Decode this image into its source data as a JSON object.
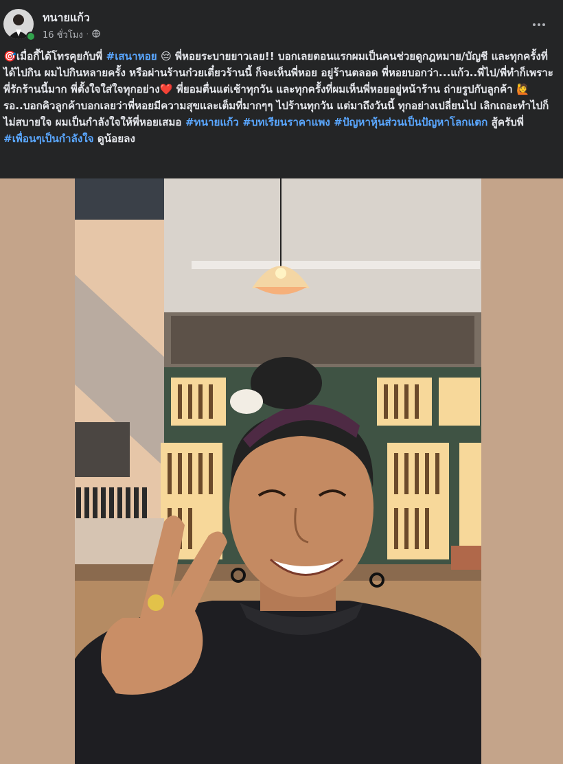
{
  "post": {
    "author": "ทนายแก้ว",
    "time": "16 ชั่วโมง",
    "privacy_icon": "globe-icon",
    "more_icon": "more-horizontal-icon",
    "caption_segments": [
      {
        "type": "emoji",
        "text": "🎯"
      },
      {
        "type": "text",
        "text": "เมื่อกี้ได้โทรคุยกับพี่ "
      },
      {
        "type": "tag",
        "text": "#เสนาหอย"
      },
      {
        "type": "text",
        "text": " 😔 พี่หอยระบายยาวเลย!! บอกเลยตอนแรกผมเป็นคนช่วยดูกฎหมาย/บัญชี และทุกครั้งที่ได้ไปกิน ผมไปกินหลายครั้ง หรือผ่านร้านก๋วยเตี๋ยวร้านนี้ ก็จะเห็นพี่หอย อยู่ร้านตลอด พี่หอยบอกว่า...แก้ว..พี่ไป/พี่ทำก็เพราะพี่รักร้านนี้มาก พี่ตั้งใจใส่ใจทุกอย่าง"
      },
      {
        "type": "heart",
        "text": "❤️"
      },
      {
        "type": "text",
        "text": " พี่ยอมตื่นแต่เช้าทุกวัน และทุกครั้งที่ผมเห็นพี่หอยอยู่หน้าร้าน ถ่ายรูปกับลูกค้า 🙋รอ..บอกคิวลูกค้าบอกเลยว่าพี่หอยมีความสุขและเต็มที่มากๆๆ ไปร้านทุกวัน แต่มาถึงวันนี้ ทุกอย่างเปลี่ยนไป เลิกเถอะทำไปก็ไม่สบายใจ ผมเป็นกำลังใจให้พี่หอยเสมอ "
      },
      {
        "type": "tag",
        "text": "#ทนายแก้ว"
      },
      {
        "type": "text",
        "text": " "
      },
      {
        "type": "tag",
        "text": "#บทเรียนราคาแพง"
      },
      {
        "type": "text",
        "text": " "
      },
      {
        "type": "tag",
        "text": "#ปัญหาหุ้นส่วนเป็นปัญหาโลกแตก"
      },
      {
        "type": "text",
        "text": " สู้ครับพี่ "
      },
      {
        "type": "tag",
        "text": "#เพื่อนๆเป็นกำลังใจ"
      },
      {
        "type": "text",
        "text": " ดูน้อยลง"
      }
    ]
  },
  "colors": {
    "background": "#242526",
    "text": "#e4e6eb",
    "secondary_text": "#b0b3b8",
    "link": "#5aa7ff",
    "online": "#31a24c",
    "media_background": "#c4a48a"
  }
}
